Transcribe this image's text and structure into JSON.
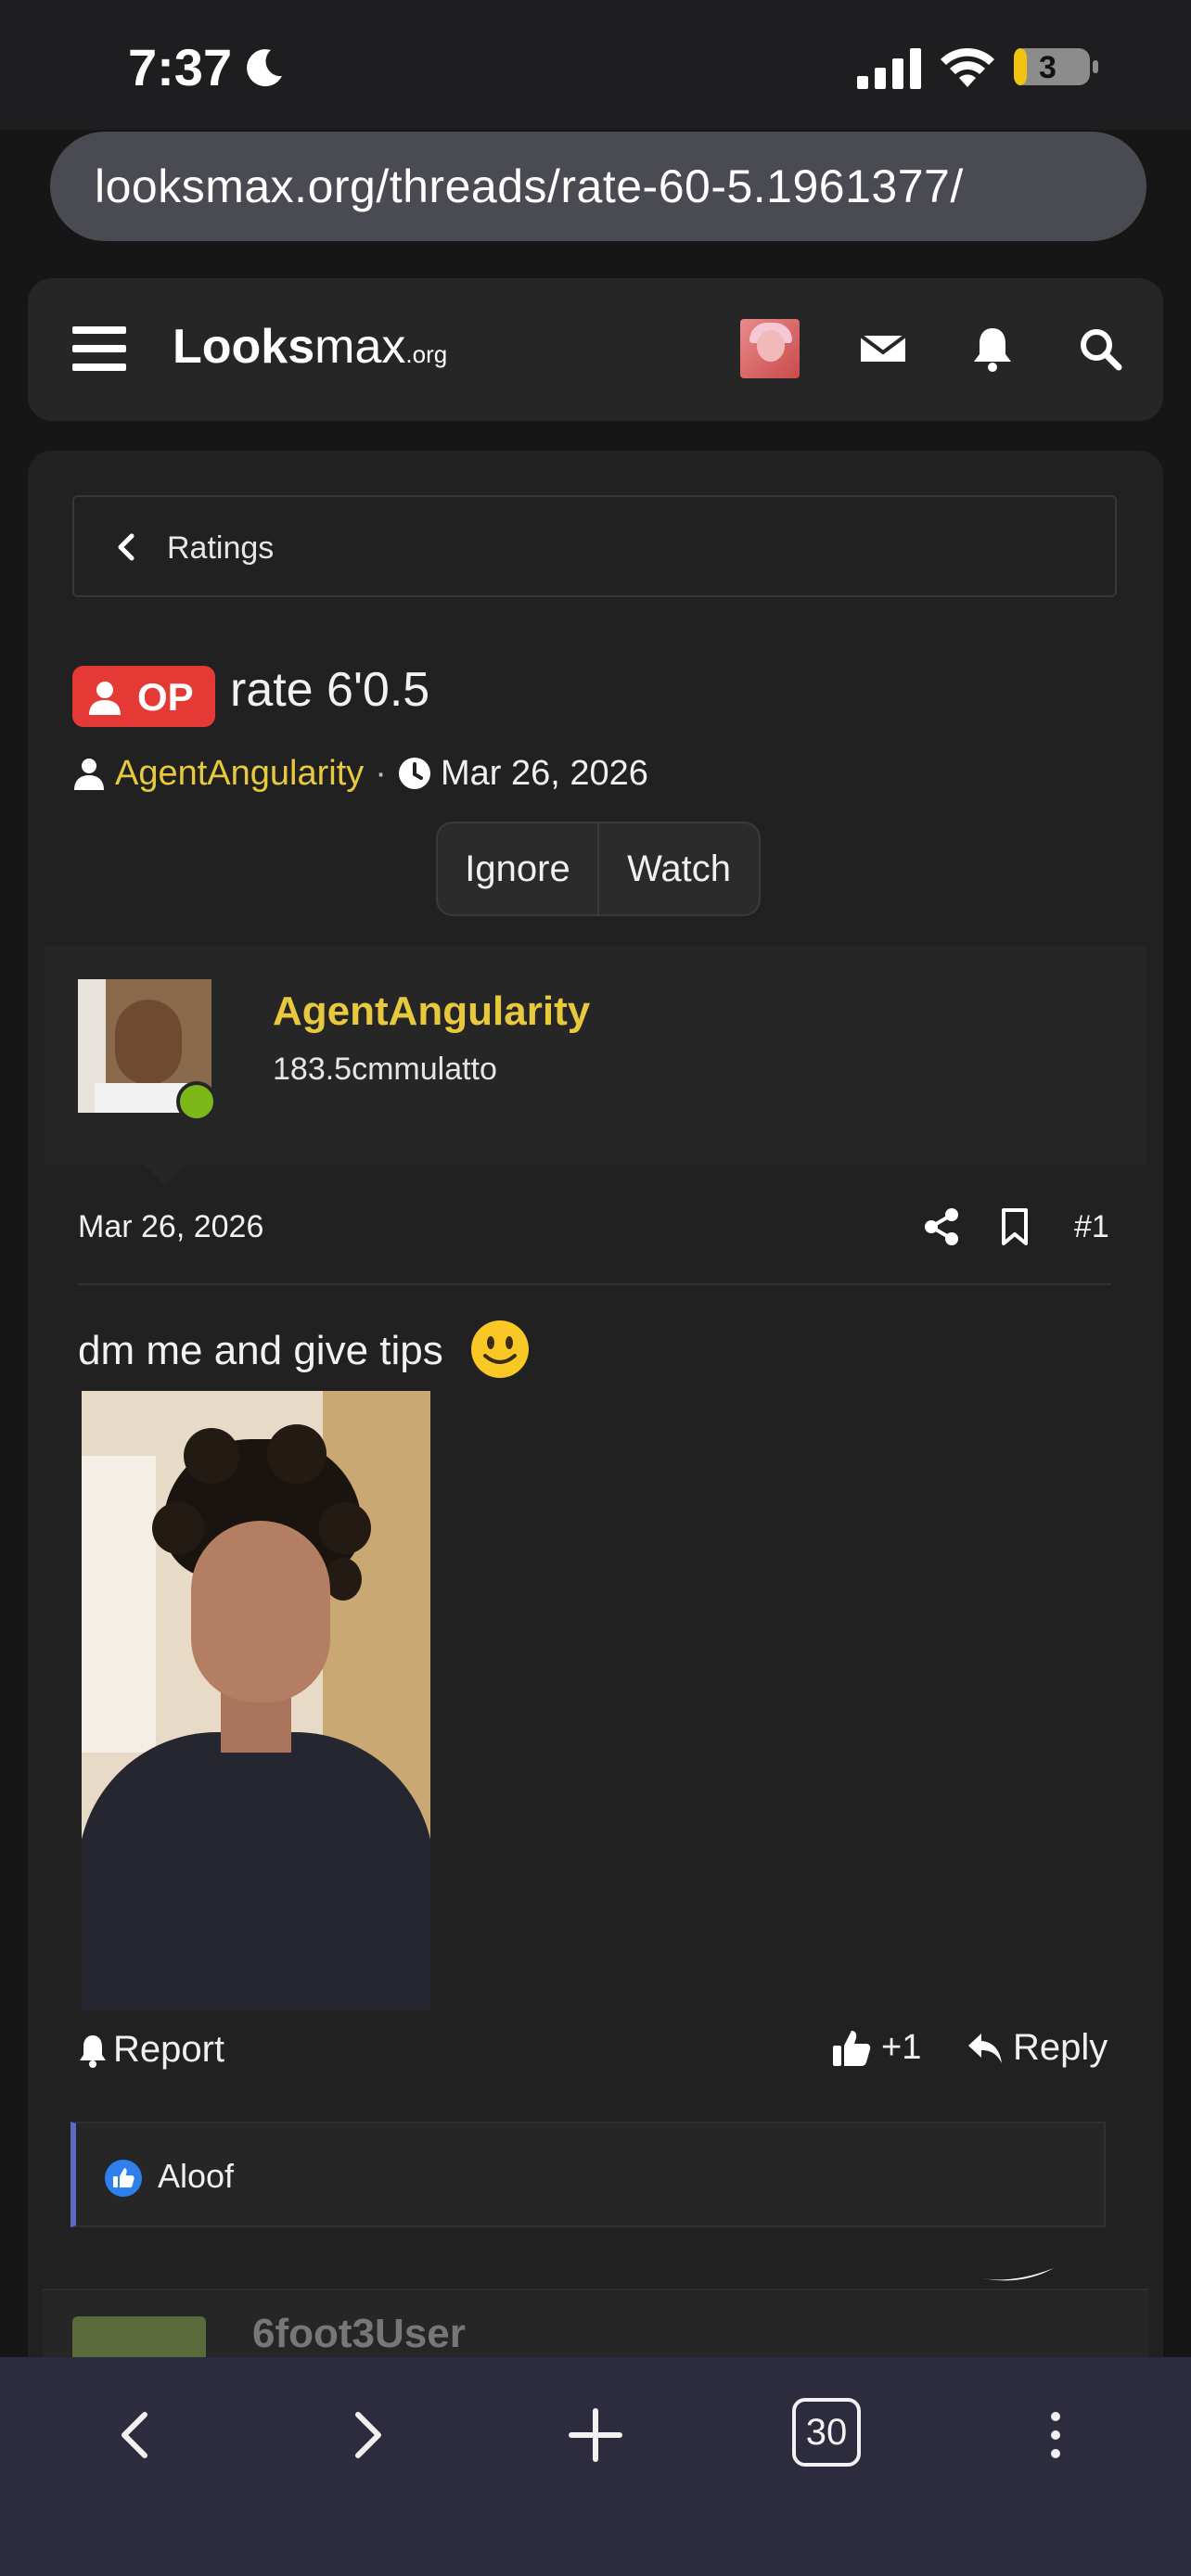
{
  "status_bar": {
    "time": "7:37",
    "battery": "3"
  },
  "browser": {
    "url": "looksmax.org/threads/rate-60-5.1961377/",
    "tab_count": "30"
  },
  "site": {
    "logo_main": "Looks",
    "logo_light": "max",
    "logo_suffix": ".org"
  },
  "thread": {
    "breadcrumb": "Ratings",
    "prefix": "OP",
    "title": "rate 6'0.5",
    "author": "AgentAngularity",
    "separator": "·",
    "date": "Mar 26, 2026",
    "actions": [
      "Ignore",
      "Watch"
    ]
  },
  "post": {
    "username": "AgentAngularity",
    "user_title": "183.5cmmulatto",
    "date": "Mar 26, 2026",
    "number": "#1",
    "text": "dm me and give tips",
    "report_label": "Report",
    "like_label": "+1",
    "reply_label": "Reply",
    "reaction_user": "Aloof"
  },
  "next_post": {
    "username": "6foot3User"
  },
  "icons": {
    "menu": "hamburger-icon",
    "messages": "envelope-icon",
    "alerts": "bell-icon",
    "search": "search-icon",
    "share": "share-icon",
    "bookmark": "bookmark-icon",
    "like": "thumbs-up-icon",
    "reply": "reply-icon",
    "back": "chevron-left-icon",
    "forward": "chevron-right-icon",
    "new_tab": "plus-icon",
    "more": "more-vertical-icon"
  },
  "colors": {
    "accent_username": "#e8c93d",
    "op_badge": "#e53935",
    "online": "#7cb81a",
    "reaction_bar": "#5c6bc0"
  }
}
